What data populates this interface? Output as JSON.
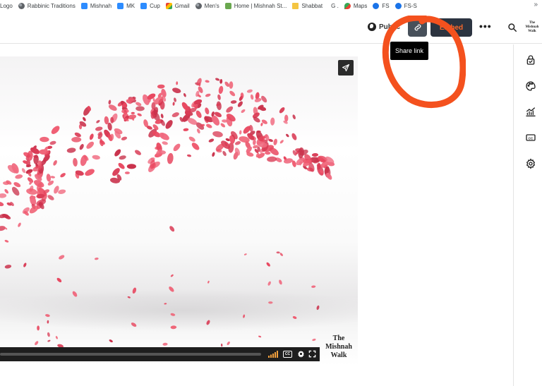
{
  "bookmarks": [
    {
      "label": "Logo",
      "icon": "zoom-icon"
    },
    {
      "label": "Rabbinic Traditions",
      "icon": "globe-icon"
    },
    {
      "label": "Mishnah",
      "icon": "zoom-icon"
    },
    {
      "label": "MK",
      "icon": "zoom-icon"
    },
    {
      "label": "Cup",
      "icon": "zoom-icon"
    },
    {
      "label": "Gmail",
      "icon": "gmail-icon"
    },
    {
      "label": "Men's",
      "icon": "globe-icon"
    },
    {
      "label": "Home | Mishnah St...",
      "icon": "home-icon"
    },
    {
      "label": "Shabbat",
      "icon": "folder-icon"
    },
    {
      "label": "G .",
      "icon": "google-icon"
    },
    {
      "label": "Maps",
      "icon": "maps-icon"
    },
    {
      "label": "FS",
      "icon": "fs-icon"
    },
    {
      "label": "FS-S",
      "icon": "fs-icon"
    }
  ],
  "bookmarks_more": "»",
  "toolbar": {
    "public_label": "Public",
    "embed_label": "Embed",
    "more_label": "•••",
    "brand_text": [
      "The",
      "Mishnah",
      "Walk"
    ]
  },
  "tooltip": {
    "text": "Share link"
  },
  "video": {
    "watermark": [
      "The",
      "Mishnah",
      "Walk"
    ],
    "cc_label": "CC",
    "progress": 0
  },
  "colors": {
    "accent": "#ff6a2a",
    "annotation": "#f4511e",
    "petal": "#e8475f"
  },
  "sidebar_icons": [
    "lock-check-icon",
    "palette-icon",
    "analytics-icon",
    "captions-icon",
    "settings-icon"
  ]
}
